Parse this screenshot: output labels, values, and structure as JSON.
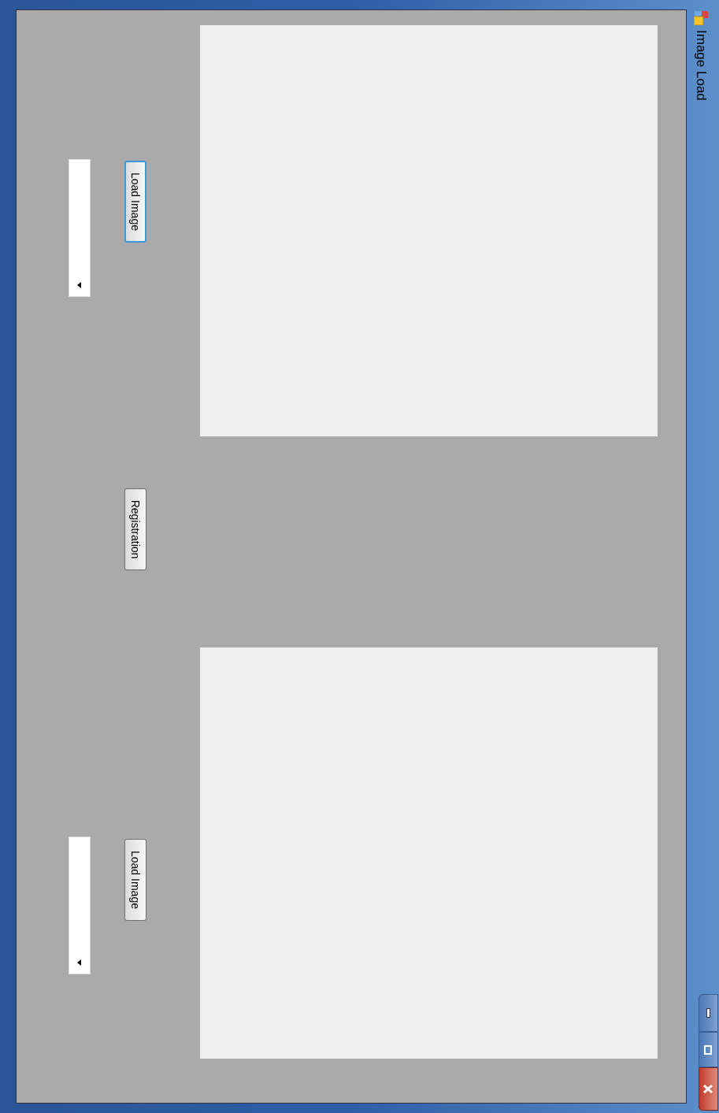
{
  "window": {
    "title": "Image Load"
  },
  "buttons": [
    {
      "label": "Load Image",
      "focused": true
    },
    {
      "label": "Registration",
      "focused": false
    },
    {
      "label": "Load Image",
      "focused": false
    }
  ]
}
